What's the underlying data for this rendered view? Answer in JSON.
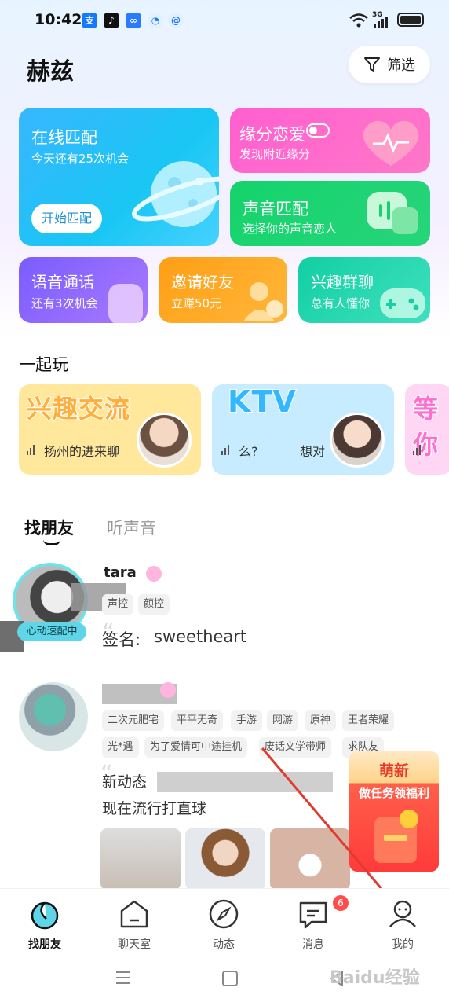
{
  "status_bar": {
    "time": "10:42",
    "signal": "3G"
  },
  "header": {
    "title": "赫兹",
    "filter_label": "筛选"
  },
  "cards": {
    "online_match": {
      "title": "在线匹配",
      "subtitle": "今天还有25次机会",
      "button": "开始匹配"
    },
    "fate_love": {
      "title": "缘分恋爱",
      "subtitle": "发现附近缘分"
    },
    "voice_match": {
      "title": "声音匹配",
      "subtitle": "选择你的声音恋人"
    },
    "voice_call": {
      "title": "语音通话",
      "subtitle": "还有3次机会"
    },
    "invite": {
      "title": "邀请好友",
      "subtitle": "立赚50元"
    },
    "interest_group": {
      "title": "兴趣群聊",
      "subtitle": "总有人懂你"
    }
  },
  "play_together": {
    "title": "一起玩",
    "rooms": [
      {
        "tag": "兴趣交流",
        "text": "扬州的进来聊"
      },
      {
        "tag": "KTV",
        "text": "么?",
        "text2": "想对"
      },
      {
        "tag": "等你"
      }
    ]
  },
  "tabs": {
    "friends": "找朋友",
    "voice": "听声音"
  },
  "users": [
    {
      "name": "tara",
      "tags": [
        "声控",
        "颜控"
      ],
      "badge": "心动速配中",
      "signature_label": "签名:",
      "signature": "sweetheart"
    },
    {
      "tags": [
        "二次元肥宅",
        "平平无奇",
        "手游",
        "网游",
        "原神",
        "王者荣耀",
        "光*遇",
        "为了爱情可中途挂机",
        "废话文学带师",
        "求队友"
      ],
      "post_line1": "新动态",
      "post_line2": "现在流行打直球"
    }
  ],
  "promo": {
    "title": "萌新",
    "subtitle": "做任务领福利"
  },
  "bottom_nav": [
    {
      "label": "找朋友"
    },
    {
      "label": "聊天室"
    },
    {
      "label": "动态"
    },
    {
      "label": "消息",
      "badge": "6"
    },
    {
      "label": "我的"
    }
  ],
  "watermark": "Baidu经验",
  "colors": {
    "accent_blue": "#19c6f3",
    "pink": "#ff5fd0",
    "green": "#14d36b",
    "purple": "#7a5cff",
    "orange": "#ff9e14",
    "teal": "#12cfa3",
    "badge_red": "#ff4d4d"
  }
}
